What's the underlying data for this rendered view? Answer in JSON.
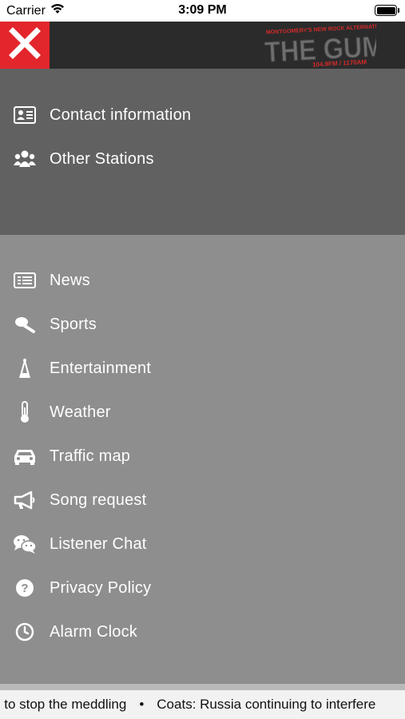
{
  "status_bar": {
    "carrier": "Carrier",
    "time": "3:09 PM"
  },
  "header": {
    "close_icon": "close-icon",
    "logo_text_top": "MONTGOMERY'S NEW ROCK ALTERNATIVE",
    "logo_title": "THE GUMP",
    "logo_freq": "104.9FM / 1170AM",
    "accent_color": "#e3262b"
  },
  "account_menu": {
    "items": [
      {
        "label": "Contact information",
        "icon": "contact-card-icon"
      },
      {
        "label": "Other Stations",
        "icon": "users-icon"
      }
    ]
  },
  "main_menu": {
    "items": [
      {
        "label": "News",
        "icon": "newspaper-icon"
      },
      {
        "label": "Sports",
        "icon": "sports-icon"
      },
      {
        "label": "Entertainment",
        "icon": "entertainment-icon"
      },
      {
        "label": "Weather",
        "icon": "thermometer-icon"
      },
      {
        "label": "Traffic map",
        "icon": "car-icon"
      },
      {
        "label": "Song request",
        "icon": "megaphone-icon"
      },
      {
        "label": "Listener Chat",
        "icon": "chat-icon"
      },
      {
        "label": "Privacy Policy",
        "icon": "question-icon"
      },
      {
        "label": "Alarm Clock",
        "icon": "clock-icon"
      }
    ]
  },
  "ticker": {
    "items": [
      "s to stop the meddling",
      "Coats: Russia continuing to interfere"
    ],
    "separator": "•"
  }
}
